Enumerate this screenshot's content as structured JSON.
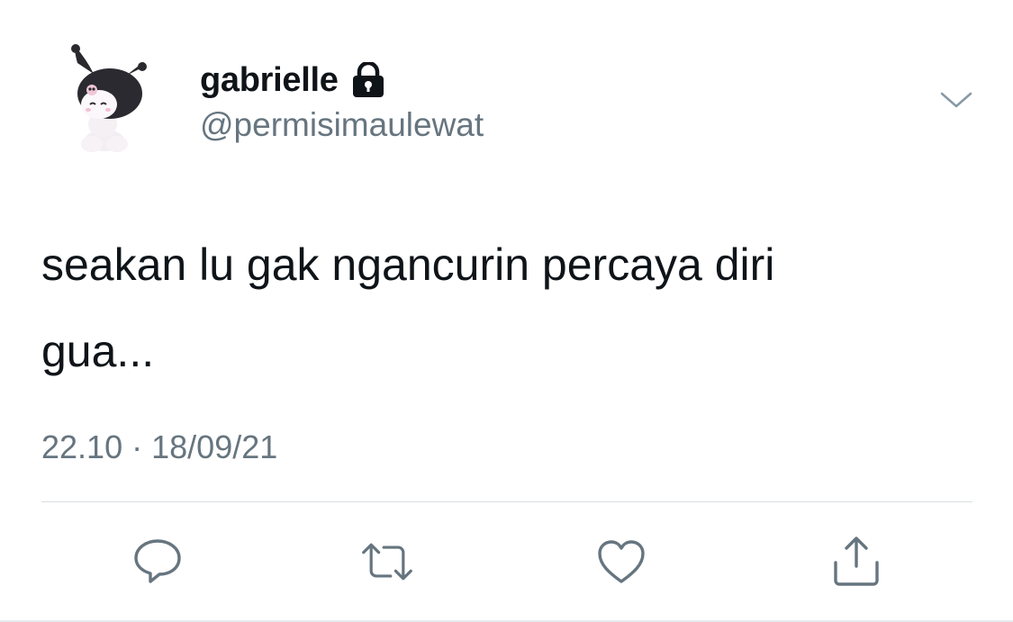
{
  "tweet": {
    "author": {
      "display_name": "gabrielle",
      "handle": "@permisimaulewat",
      "avatar_icon": "kuromi-avatar",
      "protected_icon": "lock-icon"
    },
    "menu_icon": "chevron-down-icon",
    "text": "seakan lu gak ngancurin percaya diri\ngua...",
    "time": "22.10",
    "date": "18/09/21",
    "separator": "·"
  },
  "actions": [
    {
      "name": "reply",
      "icon": "reply-icon"
    },
    {
      "name": "retweet",
      "icon": "retweet-icon"
    },
    {
      "name": "like",
      "icon": "heart-icon"
    },
    {
      "name": "share",
      "icon": "share-icon"
    }
  ],
  "colors": {
    "text_primary": "#0f1419",
    "text_secondary": "#66757f",
    "icon": "#66757f",
    "divider": "#d9dee2",
    "background": "#ffffff"
  }
}
